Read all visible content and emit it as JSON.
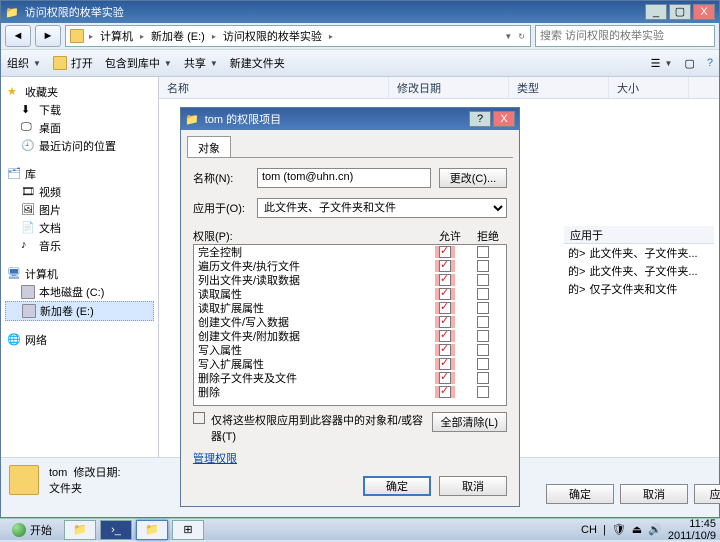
{
  "window": {
    "title": "访问权限的枚举实验",
    "buttons": {
      "min": "_",
      "max": "▢",
      "close": "X"
    }
  },
  "nav": {
    "back": "◄",
    "fwd": "►",
    "crumbs": [
      "计算机",
      "新加卷 (E:)",
      "访问权限的枚举实验"
    ],
    "search_placeholder": "搜索 访问权限的枚举实验"
  },
  "toolbar": {
    "organize": "组织",
    "open": "打开",
    "include": "包含到库中",
    "share": "共享",
    "newfolder": "新建文件夹",
    "view_icon": "☰",
    "help_icon": "?"
  },
  "columns": {
    "name": "名称",
    "date": "修改日期",
    "type": "类型",
    "size": "大小"
  },
  "tree": {
    "fav": "收藏夹",
    "fav_items": [
      "下载",
      "桌面",
      "最近访问的位置"
    ],
    "lib": "库",
    "lib_items": [
      "视频",
      "图片",
      "文档",
      "音乐"
    ],
    "pc": "计算机",
    "drives": [
      "本地磁盘 (C:)",
      "新加卷 (E:)"
    ],
    "network": "网络"
  },
  "status": {
    "name": "tom",
    "date_label": "修改日期:",
    "type": "文件夹"
  },
  "perm": {
    "title": "tom 的权限项目",
    "tab": "对象",
    "name_label": "名称(N):",
    "name_value": "tom (tom@uhn.cn)",
    "change_btn": "更改(C)...",
    "apply_label": "应用于(O):",
    "apply_value": "此文件夹、子文件夹和文件",
    "perm_label": "权限(P):",
    "col_allow": "允许",
    "col_deny": "拒绝",
    "items": [
      {
        "n": "完全控制",
        "a": true,
        "d": false
      },
      {
        "n": "遍历文件夹/执行文件",
        "a": true,
        "d": false
      },
      {
        "n": "列出文件夹/读取数据",
        "a": true,
        "d": false
      },
      {
        "n": "读取属性",
        "a": true,
        "d": false
      },
      {
        "n": "读取扩展属性",
        "a": true,
        "d": false
      },
      {
        "n": "创建文件/写入数据",
        "a": true,
        "d": false
      },
      {
        "n": "创建文件夹/附加数据",
        "a": true,
        "d": false
      },
      {
        "n": "写入属性",
        "a": true,
        "d": false
      },
      {
        "n": "写入扩展属性",
        "a": true,
        "d": false
      },
      {
        "n": "删除子文件夹及文件",
        "a": true,
        "d": false
      },
      {
        "n": "删除",
        "a": true,
        "d": false
      }
    ],
    "only_container": "仅将这些权限应用到此容器中的对象和/或容器(T)",
    "clear_all": "全部清除(L)",
    "manage": "管理权限",
    "ok": "确定",
    "cancel": "取消"
  },
  "aside": {
    "header": "应用于",
    "rows": [
      {
        "tag": "的>",
        "txt": "此文件夹、子文件夹..."
      },
      {
        "tag": "的>",
        "txt": "此文件夹、子文件夹..."
      },
      {
        "tag": "的>",
        "txt": "仅子文件夹和文件"
      }
    ]
  },
  "underbtns": {
    "ok": "确定",
    "cancel": "取消",
    "apply": "应用(A)"
  },
  "taskbar": {
    "start": "开始",
    "lang": "CH",
    "time": "11:45",
    "date": "2011/10/9"
  }
}
